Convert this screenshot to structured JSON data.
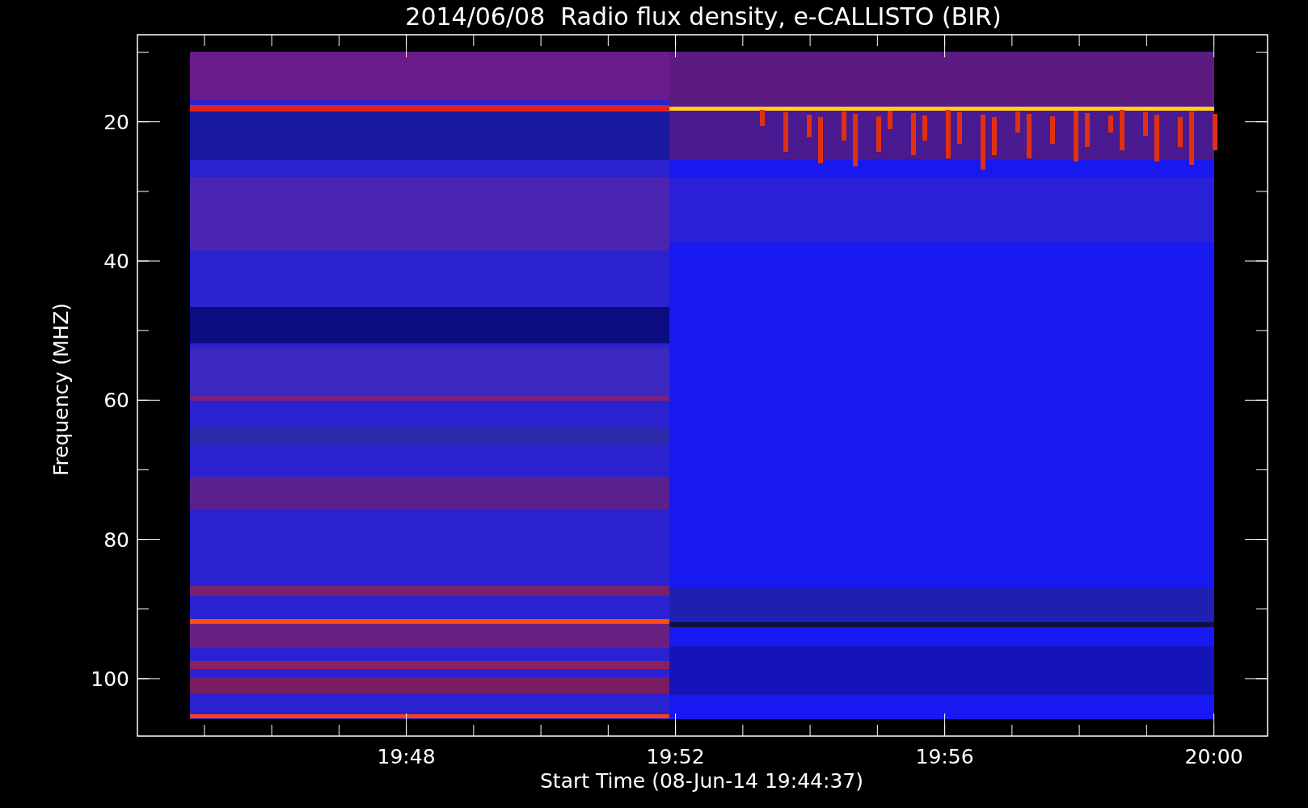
{
  "title": "2014/06/08  Radio flux density, e-CALLISTO (BIR)",
  "y_axis": {
    "label": "Frequency (MHZ)",
    "ticks": [
      "20",
      "40",
      "60",
      "80",
      "100"
    ]
  },
  "x_axis": {
    "label": "Start Time (08-Jun-14 19:44:37)",
    "ticks": [
      "19:48",
      "19:52",
      "19:56",
      "20:00"
    ]
  }
}
